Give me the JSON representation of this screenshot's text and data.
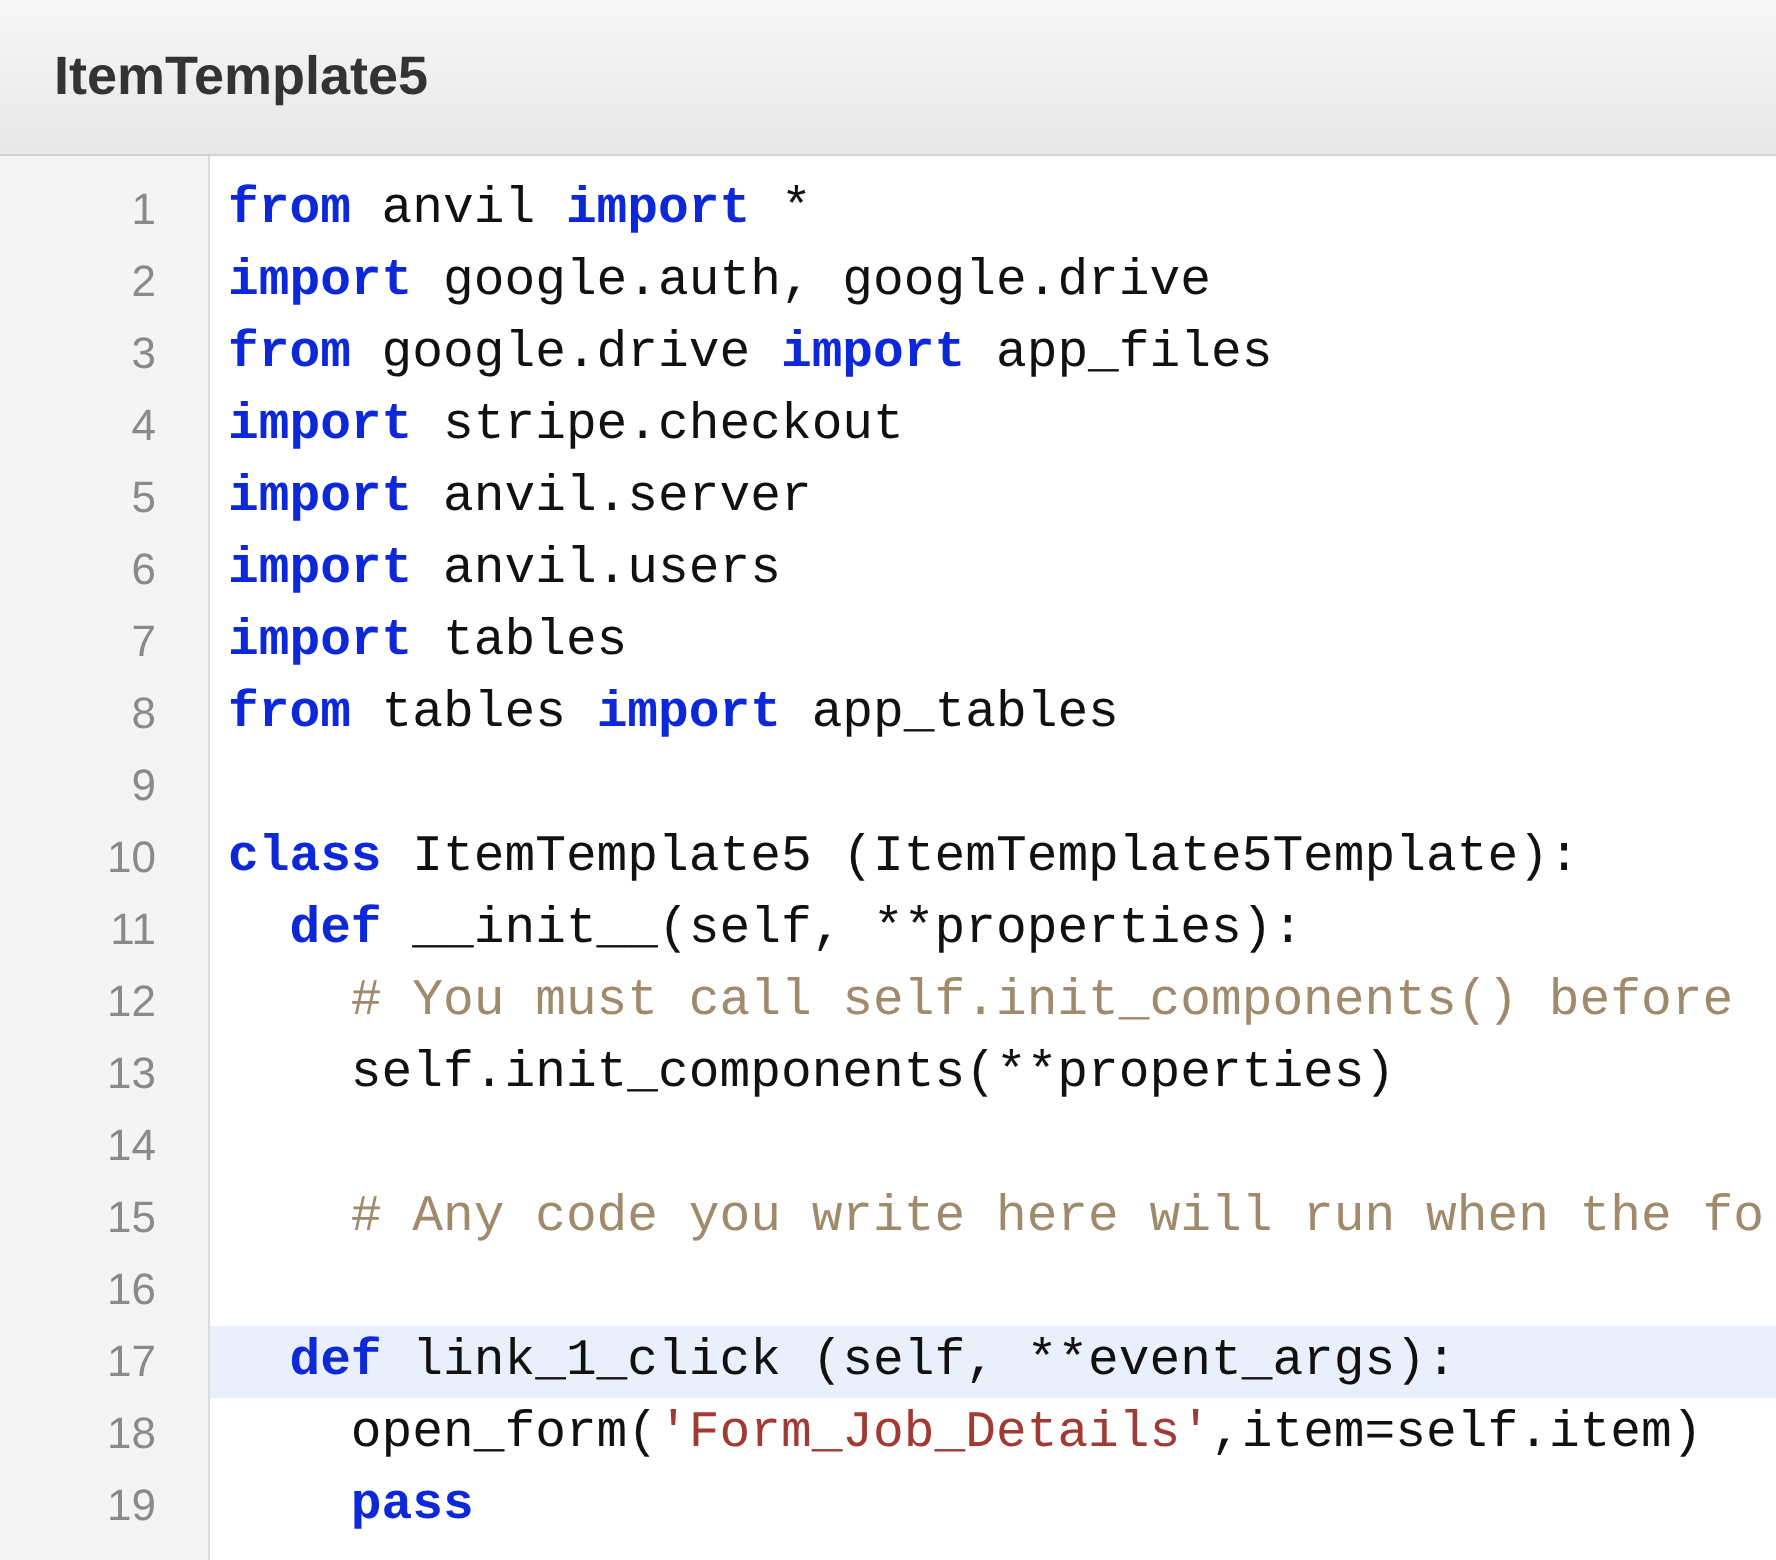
{
  "window": {
    "title": "ItemTemplate5"
  },
  "editor": {
    "lines": [
      {
        "number": "1",
        "highlighted": false,
        "tokens": [
          {
            "kind": "keyword",
            "text": "from"
          },
          {
            "kind": "plain",
            "text": " anvil "
          },
          {
            "kind": "keyword",
            "text": "import"
          },
          {
            "kind": "plain",
            "text": " *"
          }
        ]
      },
      {
        "number": "2",
        "highlighted": false,
        "tokens": [
          {
            "kind": "keyword",
            "text": "import"
          },
          {
            "kind": "plain",
            "text": " google.auth, google.drive"
          }
        ]
      },
      {
        "number": "3",
        "highlighted": false,
        "tokens": [
          {
            "kind": "keyword",
            "text": "from"
          },
          {
            "kind": "plain",
            "text": " google.drive "
          },
          {
            "kind": "keyword",
            "text": "import"
          },
          {
            "kind": "plain",
            "text": " app_files"
          }
        ]
      },
      {
        "number": "4",
        "highlighted": false,
        "tokens": [
          {
            "kind": "keyword",
            "text": "import"
          },
          {
            "kind": "plain",
            "text": " stripe.checkout"
          }
        ]
      },
      {
        "number": "5",
        "highlighted": false,
        "tokens": [
          {
            "kind": "keyword",
            "text": "import"
          },
          {
            "kind": "plain",
            "text": " anvil.server"
          }
        ]
      },
      {
        "number": "6",
        "highlighted": false,
        "tokens": [
          {
            "kind": "keyword",
            "text": "import"
          },
          {
            "kind": "plain",
            "text": " anvil.users"
          }
        ]
      },
      {
        "number": "7",
        "highlighted": false,
        "tokens": [
          {
            "kind": "keyword",
            "text": "import"
          },
          {
            "kind": "plain",
            "text": " tables"
          }
        ]
      },
      {
        "number": "8",
        "highlighted": false,
        "tokens": [
          {
            "kind": "keyword",
            "text": "from"
          },
          {
            "kind": "plain",
            "text": " tables "
          },
          {
            "kind": "keyword",
            "text": "import"
          },
          {
            "kind": "plain",
            "text": " app_tables"
          }
        ]
      },
      {
        "number": "9",
        "highlighted": false
      },
      {
        "number": "10",
        "highlighted": false,
        "tokens": [
          {
            "kind": "keyword",
            "text": "class"
          },
          {
            "kind": "plain",
            "text": " ItemTemplate5 (ItemTemplate5Template):"
          }
        ]
      },
      {
        "number": "11",
        "highlighted": false,
        "tokens": [
          {
            "kind": "keyword",
            "text": "  def"
          },
          {
            "kind": "plain",
            "text": " __init__(self, **properties):"
          }
        ]
      },
      {
        "number": "12",
        "highlighted": false,
        "tokens": [
          {
            "kind": "comment",
            "text": "    # You must call self.init_components() before"
          }
        ]
      },
      {
        "number": "13",
        "highlighted": false,
        "tokens": [
          {
            "kind": "plain",
            "text": "    self.init_components(**properties)"
          }
        ]
      },
      {
        "number": "14",
        "highlighted": false
      },
      {
        "number": "15",
        "highlighted": false,
        "tokens": [
          {
            "kind": "comment",
            "text": "    # Any code you write here will run when the fo"
          }
        ]
      },
      {
        "number": "16",
        "highlighted": false
      },
      {
        "number": "17",
        "highlighted": true,
        "tokens": [
          {
            "kind": "keyword",
            "text": "  def"
          },
          {
            "kind": "plain",
            "text": " link_1_click (self, **event_args):"
          }
        ]
      },
      {
        "number": "18",
        "highlighted": false,
        "tokens": [
          {
            "kind": "plain",
            "text": "    open_form("
          },
          {
            "kind": "string",
            "text": "'Form_Job_Details'"
          },
          {
            "kind": "plain",
            "text": ",item=self.item)"
          }
        ]
      },
      {
        "number": "19",
        "highlighted": false,
        "tokens": [
          {
            "kind": "keyword",
            "text": "    pass"
          }
        ]
      }
    ]
  }
}
